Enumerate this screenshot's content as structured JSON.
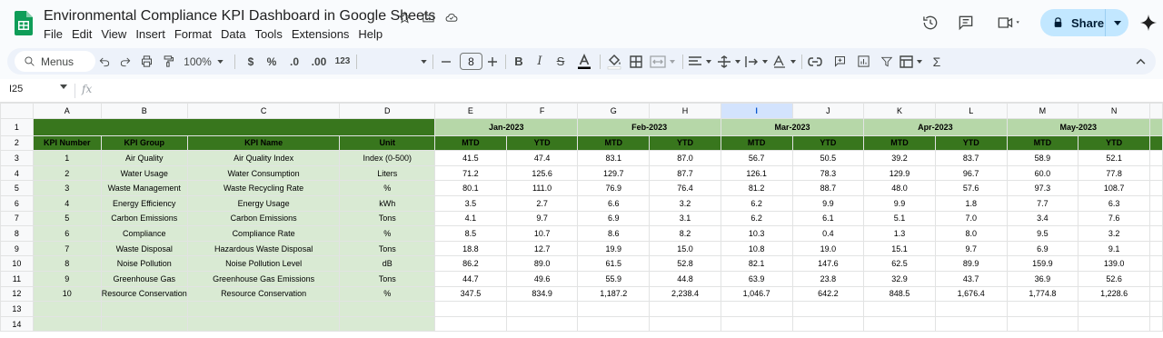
{
  "app": {
    "doc_title": "Environmental Compliance KPI Dashboard in Google Sheets",
    "menu": [
      "File",
      "Edit",
      "View",
      "Insert",
      "Format",
      "Data",
      "Tools",
      "Extensions",
      "Help"
    ],
    "share_label": "Share"
  },
  "toolbar": {
    "menus_label": "Menus",
    "zoom": "100%",
    "currency": "$",
    "percent": "%",
    "dec_decrease": ".0",
    "dec_increase": ".00",
    "number_format": "123",
    "font_size": "8"
  },
  "formula_bar": {
    "cell_ref": "I25",
    "fx": "fx"
  },
  "columns": [
    "A",
    "B",
    "C",
    "D",
    "E",
    "F",
    "G",
    "H",
    "I",
    "J",
    "K",
    "L",
    "M",
    "N"
  ],
  "selected_column": "I",
  "row_numbers": [
    "1",
    "2",
    "3",
    "4",
    "5",
    "6",
    "7",
    "8",
    "9",
    "10",
    "11",
    "12",
    "13",
    "14"
  ],
  "months": [
    "Jan-2023",
    "Feb-2023",
    "Mar-2023",
    "Apr-2023",
    "May-2023"
  ],
  "headers": {
    "kpi_number": "KPI Number",
    "kpi_group": "KPI Group",
    "kpi_name": "KPI Name",
    "unit": "Unit",
    "mtd": "MTD",
    "ytd": "YTD"
  },
  "kpis": [
    {
      "num": "1",
      "group": "Air Quality",
      "name": "Air Quality Index",
      "unit": "Index (0-500)",
      "vals": [
        "41.5",
        "47.4",
        "83.1",
        "87.0",
        "56.7",
        "50.5",
        "39.2",
        "83.7",
        "58.9",
        "52.1"
      ]
    },
    {
      "num": "2",
      "group": "Water Usage",
      "name": "Water Consumption",
      "unit": "Liters",
      "vals": [
        "71.2",
        "125.6",
        "129.7",
        "87.7",
        "126.1",
        "78.3",
        "129.9",
        "96.7",
        "60.0",
        "77.8"
      ]
    },
    {
      "num": "3",
      "group": "Waste Management",
      "name": "Waste Recycling Rate",
      "unit": "%",
      "vals": [
        "80.1",
        "111.0",
        "76.9",
        "76.4",
        "81.2",
        "88.7",
        "48.0",
        "57.6",
        "97.3",
        "108.7"
      ]
    },
    {
      "num": "4",
      "group": "Energy Efficiency",
      "name": "Energy Usage",
      "unit": "kWh",
      "vals": [
        "3.5",
        "2.7",
        "6.6",
        "3.2",
        "6.2",
        "9.9",
        "9.9",
        "1.8",
        "7.7",
        "6.3"
      ]
    },
    {
      "num": "5",
      "group": "Carbon Emissions",
      "name": "Carbon Emissions",
      "unit": "Tons",
      "vals": [
        "4.1",
        "9.7",
        "6.9",
        "3.1",
        "6.2",
        "6.1",
        "5.1",
        "7.0",
        "3.4",
        "7.6"
      ]
    },
    {
      "num": "6",
      "group": "Compliance",
      "name": "Compliance Rate",
      "unit": "%",
      "vals": [
        "8.5",
        "10.7",
        "8.6",
        "8.2",
        "10.3",
        "0.4",
        "1.3",
        "8.0",
        "9.5",
        "3.2"
      ]
    },
    {
      "num": "7",
      "group": "Waste Disposal",
      "name": "Hazardous Waste Disposal",
      "unit": "Tons",
      "vals": [
        "18.8",
        "12.7",
        "19.9",
        "15.0",
        "10.8",
        "19.0",
        "15.1",
        "9.7",
        "6.9",
        "9.1"
      ]
    },
    {
      "num": "8",
      "group": "Noise Pollution",
      "name": "Noise Pollution Level",
      "unit": "dB",
      "vals": [
        "86.2",
        "89.0",
        "61.5",
        "52.8",
        "82.1",
        "147.6",
        "62.5",
        "89.9",
        "159.9",
        "139.0"
      ]
    },
    {
      "num": "9",
      "group": "Greenhouse Gas",
      "name": "Greenhouse Gas Emissions",
      "unit": "Tons",
      "vals": [
        "44.7",
        "49.6",
        "55.9",
        "44.8",
        "63.9",
        "23.8",
        "32.9",
        "43.7",
        "36.9",
        "52.6"
      ]
    },
    {
      "num": "10",
      "group": "Resource Conservation",
      "name": "Resource Conservation",
      "unit": "%",
      "vals": [
        "347.5",
        "834.9",
        "1,187.2",
        "2,238.4",
        "1,046.7",
        "642.2",
        "848.5",
        "1,676.4",
        "1,774.8",
        "1,228.6"
      ]
    }
  ],
  "colors": {
    "header_dark_green": "#38761d",
    "month_light_green": "#b6d7a8",
    "kpi_cell_green": "#d9ead3",
    "share_bg": "#c2e7ff",
    "selected_col": "#d3e3fd"
  }
}
